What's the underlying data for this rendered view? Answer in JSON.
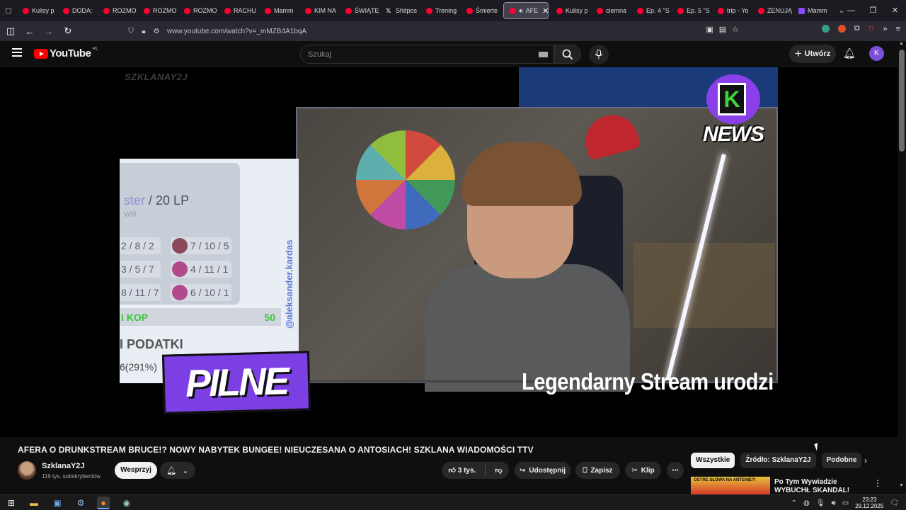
{
  "browser": {
    "tabs": [
      {
        "label": "Kulisy p",
        "icon": "youtube"
      },
      {
        "label": "DODA:",
        "icon": "youtube"
      },
      {
        "label": "ROZMO",
        "icon": "youtube"
      },
      {
        "label": "ROZMO",
        "icon": "youtube"
      },
      {
        "label": "ROZMO",
        "icon": "youtube"
      },
      {
        "label": "RACHU",
        "icon": "youtube"
      },
      {
        "label": "Mamm",
        "icon": "youtube"
      },
      {
        "label": "KIM NA",
        "icon": "youtube"
      },
      {
        "label": "ŚWIĄTE",
        "icon": "youtube"
      },
      {
        "label": "Shitpos",
        "icon": "x"
      },
      {
        "label": "Trening",
        "icon": "youtube"
      },
      {
        "label": "Śmierte",
        "icon": "youtube"
      },
      {
        "label": "AFE",
        "icon": "youtube",
        "active": true
      },
      {
        "label": "Kulisy p",
        "icon": "youtube"
      },
      {
        "label": "ciemna",
        "icon": "youtube"
      },
      {
        "label": "Ep. 4 \"S",
        "icon": "youtube"
      },
      {
        "label": "Ep. 5 \"S",
        "icon": "youtube"
      },
      {
        "label": "trip - Yo",
        "icon": "youtube"
      },
      {
        "label": "ZENUJĄ",
        "icon": "youtube"
      },
      {
        "label": "Mamm",
        "icon": "purple"
      }
    ],
    "url": "www.youtube.com/watch?v=_mMZB4A1bqA",
    "extension_badge": "71"
  },
  "youtube": {
    "logo_text": "YouTube",
    "country_code": "PL",
    "search_placeholder": "Szukaj",
    "create_label": "Utwórz",
    "avatar_letter": "K"
  },
  "video_overlay": {
    "watermark": "SZKLANAY2J",
    "rank_text": "ster",
    "lp_text": "20 LP",
    "wr_text": "WR",
    "scores_left": [
      "2 / 8 / 2",
      "3 / 5 / 7",
      "8 / 11 / 7"
    ],
    "scores_right": [
      "7 / 10 / 5",
      "4 / 11 / 1",
      "6 / 10 / 1"
    ],
    "bar_label": "I KOP",
    "bar_value": "50",
    "handle": "@aleksander.kardas",
    "podatki": "I PODATKI",
    "percent": "6(291%)",
    "pilne": "PILNE",
    "news": "NEWS",
    "legend_caption": "Legendarny Stream urodzi"
  },
  "video_info": {
    "title": "AFERA O DRUNKSTREAM BRUCE!? NOWY NABYTEK BUNGEE! NIEUCZESANA O ANTOSIACH! SZKLANA WIADOMOŚCI TTV",
    "channel_name": "SzklanaY2J",
    "subscribers": "119 tys. subskrybentów",
    "support_label": "Wesprzyj",
    "likes": "3 tys.",
    "share_label": "Udostępnij",
    "save_label": "Zapisz",
    "clip_label": "Klip"
  },
  "recommendations": {
    "chips": [
      {
        "label": "Wszystkie",
        "active": true
      },
      {
        "label": "Źródło: SzklanaY2J",
        "active": false
      },
      {
        "label": "Podobne",
        "active": false
      }
    ],
    "first_title": "Po Tym Wywiadzie WYBUCHŁ SKANDAL! Wściekły Stanowski",
    "first_thumb_text": "OSTRE SŁOWA NA ANTENIE?!"
  },
  "taskbar": {
    "time": "23:23",
    "date": "29.12.2025"
  }
}
